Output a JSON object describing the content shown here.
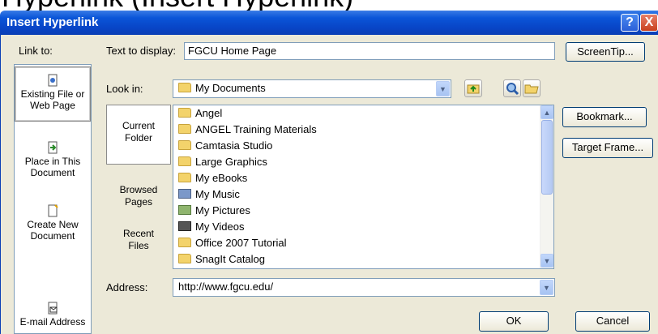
{
  "caption": "Hyperlink (Insert Hyperlink)",
  "window": {
    "title": "Insert Hyperlink",
    "help_glyph": "?",
    "close_glyph": "X"
  },
  "link_to": {
    "label": "Link to:",
    "items": [
      {
        "line1": "Existing File or",
        "line2": "Web Page",
        "icon": "existing-file-icon"
      },
      {
        "line1": "Place in This",
        "line2": "Document",
        "icon": "place-in-document-icon"
      },
      {
        "line1": "Create New",
        "line2": "Document",
        "icon": "new-document-icon"
      },
      {
        "line1": "E-mail Address",
        "line2": "",
        "icon": "email-address-icon"
      }
    ]
  },
  "text_to_display": {
    "label": "Text to display:",
    "value": "FGCU Home Page"
  },
  "screentip_button": "ScreenTip...",
  "look_in": {
    "label": "Look in:",
    "value": "My Documents"
  },
  "nav": [
    {
      "line1": "Current",
      "line2": "Folder"
    },
    {
      "line1": "Browsed",
      "line2": "Pages"
    },
    {
      "line1": "Recent",
      "line2": "Files"
    }
  ],
  "files": [
    {
      "name": "Angel",
      "icon": "folder-icon"
    },
    {
      "name": "ANGEL Training Materials",
      "icon": "folder-icon"
    },
    {
      "name": "Camtasia Studio",
      "icon": "folder-icon"
    },
    {
      "name": "Large Graphics",
      "icon": "folder-icon"
    },
    {
      "name": "My eBooks",
      "icon": "folder-icon"
    },
    {
      "name": "My Music",
      "icon": "music-folder-icon"
    },
    {
      "name": "My Pictures",
      "icon": "pictures-folder-icon"
    },
    {
      "name": "My Videos",
      "icon": "videos-folder-icon"
    },
    {
      "name": "Office 2007 Tutorial",
      "icon": "folder-icon"
    },
    {
      "name": "SnagIt Catalog",
      "icon": "folder-icon"
    }
  ],
  "side_buttons": {
    "bookmark": "Bookmark...",
    "target_frame": "Target Frame..."
  },
  "address": {
    "label": "Address:",
    "value": "http://www.fgcu.edu/"
  },
  "ok": "OK",
  "cancel": "Cancel",
  "colors": {
    "titlebar": "#0a55d8",
    "dialog_bg": "#ece9d8",
    "border": "#7f9db9"
  }
}
